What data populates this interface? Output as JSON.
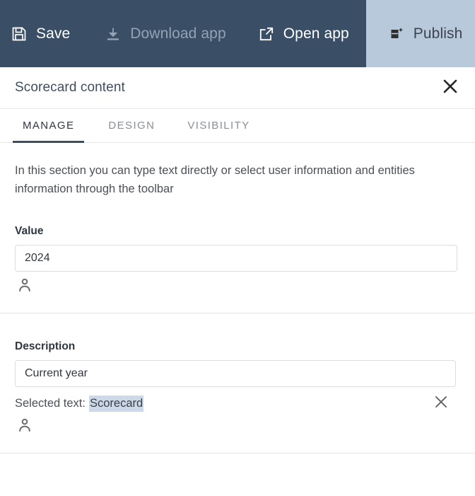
{
  "toolbar": {
    "buttons": [
      {
        "label": "Save",
        "icon": "floppy-disk-icon",
        "state": "enabled"
      },
      {
        "label": "Download app",
        "icon": "download-icon",
        "state": "disabled"
      },
      {
        "label": "Open app",
        "icon": "external-link-icon",
        "state": "enabled"
      },
      {
        "label": "Publish",
        "icon": "publish-icon",
        "state": "highlighted"
      }
    ],
    "background_color": "#3a4f66",
    "publish_background_color": "#b8c9db"
  },
  "panel": {
    "title": "Scorecard content",
    "close_icon": "close-icon"
  },
  "tabs": [
    {
      "label": "MANAGE",
      "active": true
    },
    {
      "label": "DESIGN",
      "active": false
    },
    {
      "label": "VISIBILITY",
      "active": false
    }
  ],
  "main": {
    "intro": "In this section you can type text directly or select user information and entities information through the toolbar",
    "value_field": {
      "label": "Value",
      "value": "2024",
      "placeholder": "",
      "person_icon": "person-icon"
    },
    "description_field": {
      "label": "Description",
      "value": "Current year",
      "placeholder": "",
      "person_icon": "person-icon",
      "selected_text_label": "Selected text:",
      "selected_text_value": "Scorecard",
      "selected_text_highlight_color": "#ccd9e8",
      "clear_icon": "close-icon"
    }
  }
}
